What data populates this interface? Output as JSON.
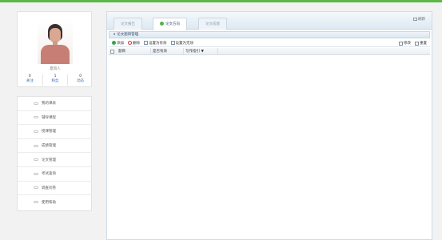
{
  "profile": {
    "username": "夏雨人",
    "stats": [
      {
        "value": "0",
        "label": "关注"
      },
      {
        "value": "1",
        "label": "粉丝"
      },
      {
        "value": "0",
        "label": "动态"
      }
    ]
  },
  "menu": [
    {
      "label": "我的课表"
    },
    {
      "label": "辅导课程"
    },
    {
      "label": "授课管理"
    },
    {
      "label": "成绩管理"
    },
    {
      "label": "论文管理"
    },
    {
      "label": "考试查询"
    },
    {
      "label": "调查问卷"
    },
    {
      "label": "使用帮助"
    }
  ],
  "tabs": [
    {
      "label": "论文报告",
      "active": false
    },
    {
      "label": "论文方向",
      "active": true
    },
    {
      "label": "论文成绩",
      "active": false
    }
  ],
  "tab_right_label": "刷新",
  "section_title": "论文题目管理",
  "toolbar": {
    "add": "添加",
    "delete": "删除",
    "set_valid": "设置为有效",
    "set_invalid": "设置为无效",
    "edit": "修改",
    "reset": "重置"
  },
  "grid": {
    "columns": [
      "题目",
      "是否有效",
      "写作指引"
    ],
    "sort_indicator": "▼"
  },
  "colors": {
    "accent_green": "#5cb946",
    "panel_border": "#cfdbe6",
    "link_blue": "#3b6fb6"
  }
}
